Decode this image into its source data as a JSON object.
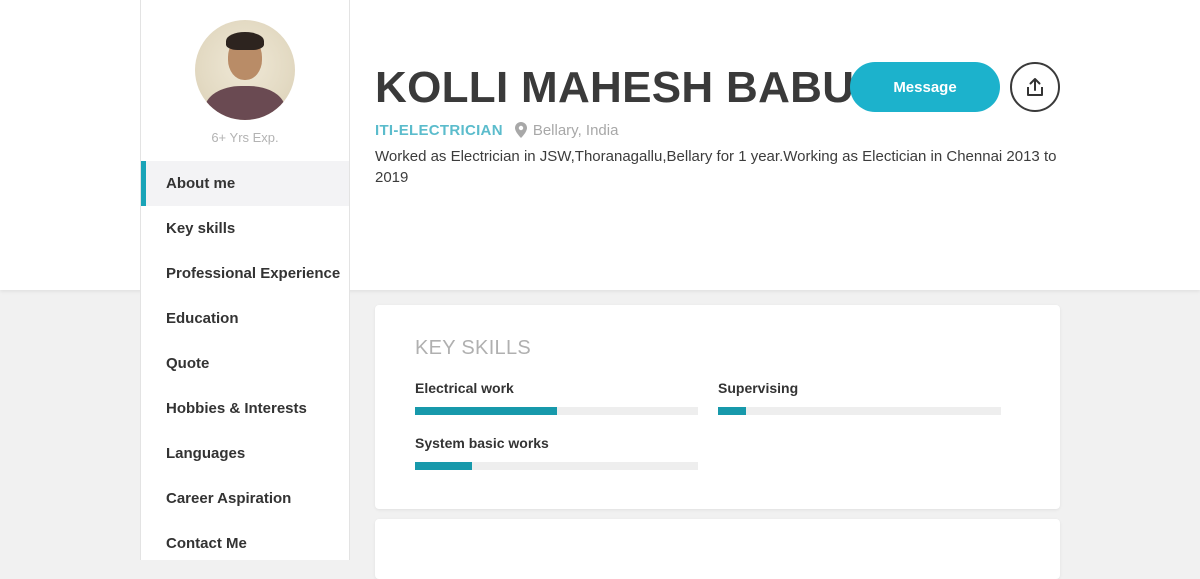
{
  "profile": {
    "name": "KOLLI MAHESH BABU",
    "role": "ITI-ELECTRICIAN",
    "location": "Bellary, India",
    "experience": "6+ Yrs Exp.",
    "description": "Worked as Electrician in JSW,Thoranagallu,Bellary for 1 year.Working as Electician in Chennai 2013 to 2019"
  },
  "actions": {
    "message_label": "Message",
    "share_icon": "share-icon"
  },
  "nav": {
    "items": [
      {
        "label": "About me",
        "active": true
      },
      {
        "label": "Key skills",
        "active": false
      },
      {
        "label": "Professional Experience",
        "active": false
      },
      {
        "label": "Education",
        "active": false
      },
      {
        "label": "Quote",
        "active": false
      },
      {
        "label": "Hobbies & Interests",
        "active": false
      },
      {
        "label": "Languages",
        "active": false
      },
      {
        "label": "Career Aspiration",
        "active": false
      },
      {
        "label": "Contact Me",
        "active": false
      }
    ]
  },
  "skills_card": {
    "title": "KEY SKILLS",
    "skills": [
      {
        "label": "Electrical work",
        "level": 0.5
      },
      {
        "label": "Supervising",
        "level": 0.1
      },
      {
        "label": "System basic works",
        "level": 0.2
      }
    ]
  },
  "colors": {
    "accent": "#1cb2cc",
    "bar_fill": "#1799ab",
    "role_text": "#5bbccc"
  }
}
